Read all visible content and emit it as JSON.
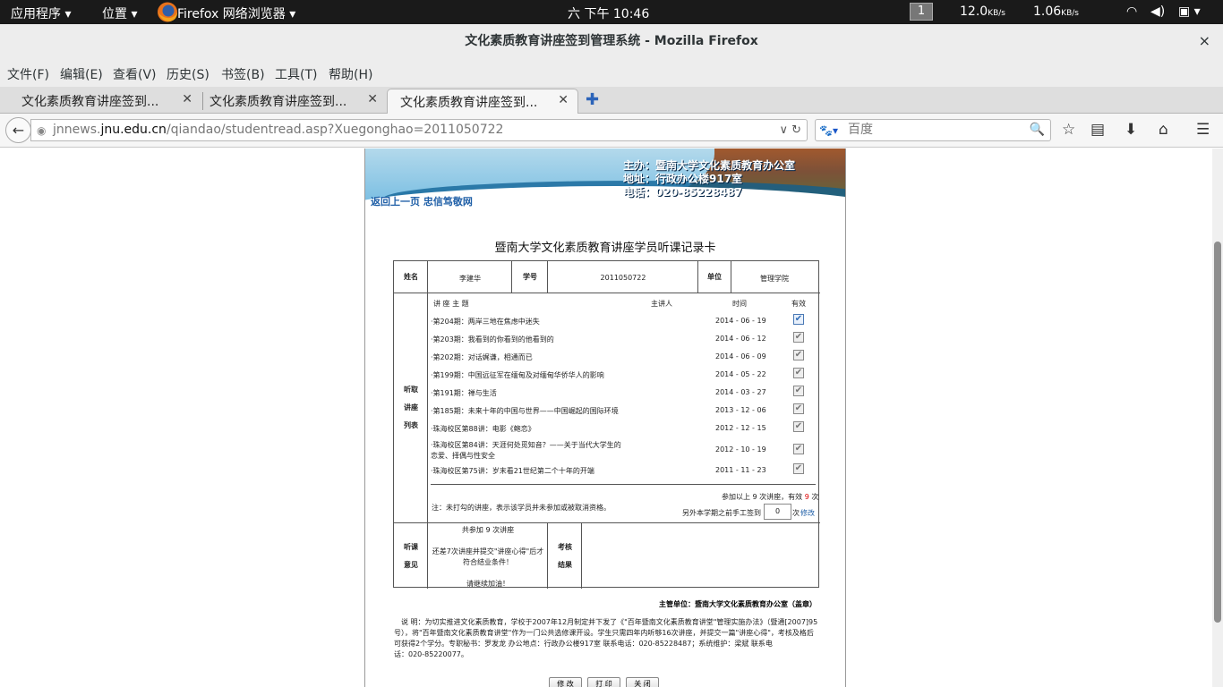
{
  "system_bar": {
    "apps": "应用程序",
    "places": "位置",
    "browser": "Firefox 网络浏览器",
    "clock": "六 下午 10:46",
    "workspace": "1",
    "net_down": "12.0",
    "net_down_unit": "KB/s",
    "net_up": "1.06",
    "net_up_unit": "KB/s"
  },
  "window": {
    "title": "文化素质教育讲座签到管理系统 - Mozilla Firefox",
    "close": "×"
  },
  "menu": [
    "文件(F)",
    "编辑(E)",
    "查看(V)",
    "历史(S)",
    "书签(B)",
    "工具(T)",
    "帮助(H)"
  ],
  "tabs": [
    {
      "label": "文化素质教育讲座签到..."
    },
    {
      "label": "文化素质教育讲座签到..."
    },
    {
      "label": "文化素质教育讲座签到..."
    }
  ],
  "navigation": {
    "url_prefix": "jnnews.",
    "url_domain": "jnu.edu.cn",
    "url_path": "/qiandao/studentread.asp?Xuegonghao=2011050722",
    "search_placeholder": "百度"
  },
  "banner": {
    "line1": "主办：暨南大学文化素质教育办公室",
    "line2": "地址：行政办公楼917室",
    "line3": "电话：020-85228487"
  },
  "back_link": "返回上一页",
  "motto_link": "忠信笃敬网",
  "card": {
    "title": "暨南大学文化素质教育讲座学员听课记录卡",
    "name_label": "姓名",
    "name_value": "李建华",
    "id_label": "学号",
    "id_value": "2011050722",
    "unit_label": "单位",
    "unit_value": "管理学院",
    "section_label_1": "听取",
    "section_label_2": "讲座",
    "section_label_3": "列表",
    "col_topic": "讲 座 主 题",
    "col_speaker": "主讲人",
    "col_time": "时间",
    "col_valid": "有效",
    "lectures": [
      {
        "topic": "·第204期：两岸三地在焦虑中迷失",
        "date": "2014 - 06 - 19",
        "checked": true
      },
      {
        "topic": "·第203期：我看到的你看到的他看到的",
        "date": "2014 - 06 - 12",
        "checked": false
      },
      {
        "topic": "·第202期：对话娓谦，相通而已",
        "date": "2014 - 06 - 09",
        "checked": false
      },
      {
        "topic": "·第199期：中国远征军在缅甸及对缅甸华侨华人的影响",
        "date": "2014 - 05 - 22",
        "checked": false
      },
      {
        "topic": "·第191期：禅与生活",
        "date": "2014 - 03 - 27",
        "checked": false
      },
      {
        "topic": "·第185期：未来十年的中国与世界——中国崛起的国际环境",
        "date": "2013 - 12 - 06",
        "checked": false
      },
      {
        "topic": "·珠海校区第88讲：电影《鲍恋》",
        "date": "2012 - 12 - 15",
        "checked": false
      },
      {
        "topic": "·珠海校区第84讲：天涯何处觅知音？——关于当代大学生的",
        "topic2": "恋爱、择偶与性安全",
        "date": "2012 - 10 - 19",
        "checked": false
      },
      {
        "topic": "·珠海校区第75讲：岁末看21世纪第二个十年的开端",
        "date": "2011 - 11 - 23",
        "checked": false
      }
    ],
    "footnote": "注：未打勾的讲座，表示该学员并未参加或被取消资格。",
    "attend_text_a": "参加以上 9 次讲座，有效",
    "attend_valid": "9",
    "attend_text_b": "次",
    "manual_label": "另外本学期之前手工签到",
    "manual_value": "0",
    "manual_unit": "次",
    "modify_link": "修改",
    "opinion_label_1": "听课",
    "opinion_label_2": "意见",
    "opinion_1": "共参加 9 次讲座",
    "opinion_2": "还差7次讲座并提交\"讲座心得\"后才",
    "opinion_3": "符合结业条件！",
    "opinion_4": "请继续加油！",
    "exam_label_1": "考核",
    "exam_label_2": "结果"
  },
  "supervisor": "主管单位：暨南大学文化素质教育办公室（盖章）",
  "notes": [
    "说 明：为切实推进文化素质教育，学校于2007年12月制定并下发了《\"百年暨南文化素质教育讲堂\"管理实施办法》（暨通[2007]95",
    "号），将\"百年暨南文化素质教育讲堂\"作为一门公共选修课开设。学生只需四年内听够16次讲座，并提交一篇\"讲座心得\"，考核及格后",
    "可获得2个学分。专职秘书：罗发龙 办公地点：行政办公楼917室 联系电话：020-85228487；系统维护：梁斌 联系电",
    "话：020-85220077。"
  ],
  "buttons": {
    "modify": "修 改",
    "print": "打 印",
    "close": "关 闭"
  }
}
